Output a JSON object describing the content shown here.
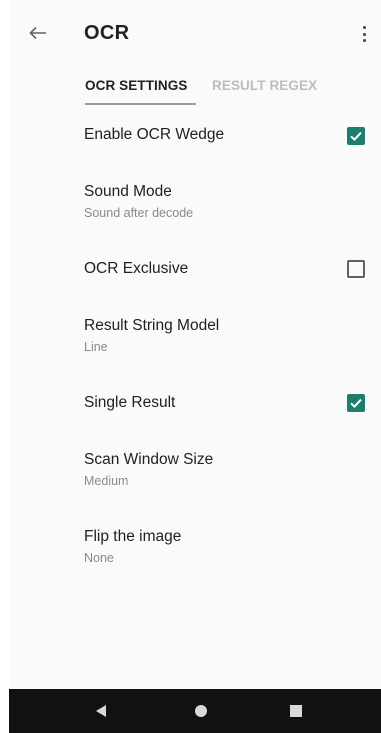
{
  "appbar": {
    "title": "OCR",
    "back_icon": "arrow-back-icon",
    "more_icon": "more-vert-icon"
  },
  "tabs": [
    {
      "label": "OCR SETTINGS",
      "active": true
    },
    {
      "label": "RESULT REGEX",
      "active": false
    }
  ],
  "settings": [
    {
      "label": "Enable OCR Wedge",
      "checkbox": true,
      "checked": true
    },
    {
      "label": "Sound Mode",
      "summary": "Sound after decode"
    },
    {
      "label": "OCR Exclusive",
      "checkbox": true,
      "checked": false
    },
    {
      "label": "Result String Model",
      "summary": "Line"
    },
    {
      "label": "Single Result",
      "checkbox": true,
      "checked": true
    },
    {
      "label": "Scan Window Size",
      "summary": "Medium"
    },
    {
      "label": "Flip the image",
      "summary": "None"
    }
  ],
  "navbar": {
    "back_icon": "nav-back-triangle-icon",
    "home_icon": "nav-home-circle-icon",
    "recents_icon": "nav-recents-square-icon"
  },
  "colors": {
    "accent": "#1e7d6d",
    "background": "#fafafa",
    "navbar": "#111111"
  }
}
